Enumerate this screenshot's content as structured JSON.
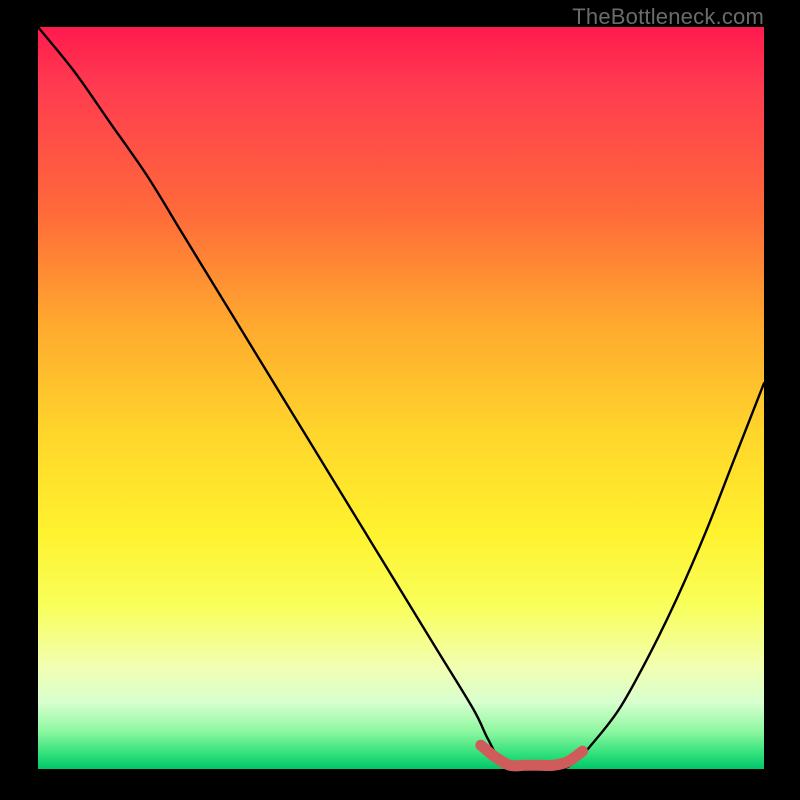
{
  "watermark": "TheBottleneck.com",
  "chart_data": {
    "type": "line",
    "title": "",
    "xlabel": "",
    "ylabel": "",
    "xlim": [
      0,
      100
    ],
    "ylim": [
      0,
      100
    ],
    "grid": false,
    "legend": false,
    "series": [
      {
        "name": "bottleneck-curve",
        "color": "#000000",
        "x": [
          0,
          5,
          10,
          15,
          20,
          25,
          30,
          35,
          40,
          45,
          50,
          55,
          60,
          62,
          64,
          68,
          72,
          74,
          76,
          80,
          84,
          88,
          92,
          96,
          100
        ],
        "y": [
          100,
          94,
          87,
          80,
          72,
          64,
          56,
          48,
          40,
          32,
          24,
          16,
          8,
          4,
          1,
          0,
          0,
          1,
          3,
          8,
          15,
          23,
          32,
          42,
          52
        ]
      },
      {
        "name": "optimal-range-marker",
        "color": "#cf5b5b",
        "x": [
          61,
          63,
          65,
          67,
          69,
          71,
          73,
          75
        ],
        "y": [
          3.2,
          1.6,
          0.5,
          0.5,
          0.5,
          0.5,
          1.0,
          2.4
        ]
      }
    ],
    "background_gradient": {
      "type": "vertical",
      "stops": [
        {
          "pos": 0.0,
          "color": "#ff1a4d"
        },
        {
          "pos": 0.25,
          "color": "#ff6a3a"
        },
        {
          "pos": 0.55,
          "color": "#ffd62b"
        },
        {
          "pos": 0.78,
          "color": "#f9ff5a"
        },
        {
          "pos": 0.95,
          "color": "#8cf7a0"
        },
        {
          "pos": 1.0,
          "color": "#00c66a"
        }
      ]
    }
  }
}
